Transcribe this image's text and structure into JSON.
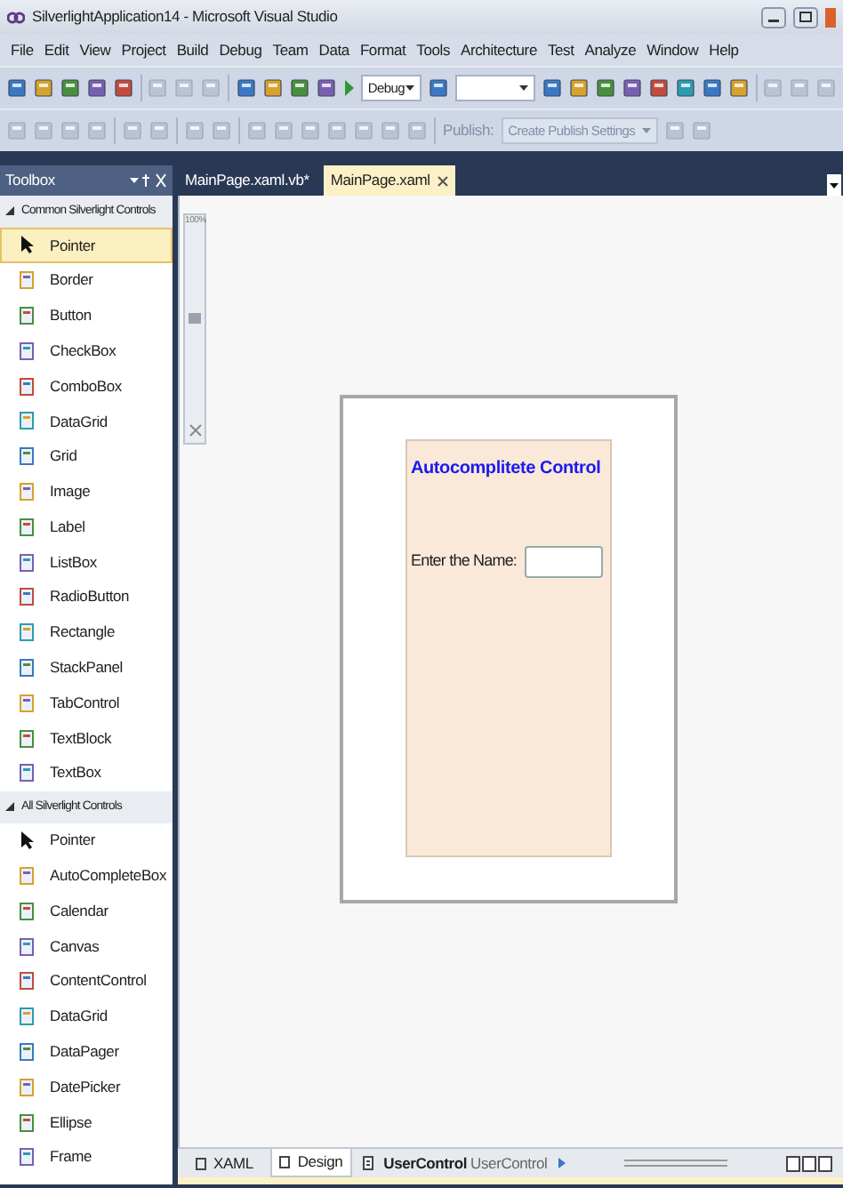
{
  "window": {
    "title": "SilverlightApplication14 - Microsoft Visual Studio"
  },
  "menu": [
    "File",
    "Edit",
    "View",
    "Project",
    "Build",
    "Debug",
    "Team",
    "Data",
    "Format",
    "Tools",
    "Architecture",
    "Test",
    "Analyze",
    "Window",
    "Help"
  ],
  "toolbar": {
    "configuration": "Debug",
    "platform_dropdown": {
      "disabled": false
    },
    "publish_label": "Publish:",
    "publish_dropdown": {
      "value": "Create Publish Settings",
      "disabled": true
    }
  },
  "toolbox": {
    "title": "Toolbox",
    "sections": [
      {
        "title": "Common Silverlight Controls",
        "expanded": true,
        "items": [
          {
            "label": "Pointer",
            "selected": true
          },
          {
            "label": "Border",
            "selected": false
          },
          {
            "label": "Button",
            "selected": false
          },
          {
            "label": "CheckBox",
            "selected": false
          },
          {
            "label": "ComboBox",
            "selected": false
          },
          {
            "label": "DataGrid",
            "selected": false
          },
          {
            "label": "Grid",
            "selected": false
          },
          {
            "label": "Image",
            "selected": false
          },
          {
            "label": "Label",
            "selected": false
          },
          {
            "label": "ListBox",
            "selected": false
          },
          {
            "label": "RadioButton",
            "selected": false
          },
          {
            "label": "Rectangle",
            "selected": false
          },
          {
            "label": "StackPanel",
            "selected": false
          },
          {
            "label": "TabControl",
            "selected": false
          },
          {
            "label": "TextBlock",
            "selected": false
          },
          {
            "label": "TextBox",
            "selected": false
          }
        ]
      },
      {
        "title": "All Silverlight Controls",
        "expanded": true,
        "items": [
          {
            "label": "Pointer",
            "selected": false
          },
          {
            "label": "AutoCompleteBox",
            "selected": false
          },
          {
            "label": "Calendar",
            "selected": false
          },
          {
            "label": "Canvas",
            "selected": false
          },
          {
            "label": "ContentControl",
            "selected": false
          },
          {
            "label": "DataGrid",
            "selected": false
          },
          {
            "label": "DataPager",
            "selected": false
          },
          {
            "label": "DatePicker",
            "selected": false
          },
          {
            "label": "Ellipse",
            "selected": false
          },
          {
            "label": "Frame",
            "selected": false
          }
        ]
      }
    ]
  },
  "document_tabs": [
    {
      "label": "MainPage.xaml.vb*",
      "selected": false
    },
    {
      "label": "MainPage.xaml",
      "selected": true
    }
  ],
  "zoom": {
    "label": "100%",
    "level": 0.55
  },
  "design": {
    "title": "Autocomplitete Control",
    "field_label": "Enter the Name:"
  },
  "view_tabs": [
    {
      "label": "XAML",
      "selected": false
    },
    {
      "label": "Design",
      "selected": true
    }
  ],
  "breadcrumb": {
    "element": "UserControl",
    "name": "UserControl"
  }
}
